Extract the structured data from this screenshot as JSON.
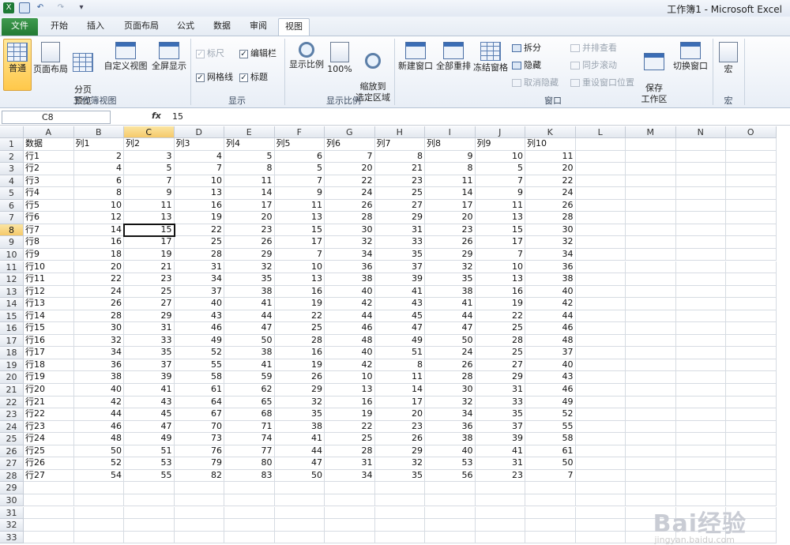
{
  "window": {
    "title": "工作簿1 - Microsoft Excel"
  },
  "tabs": [
    "文件",
    "开始",
    "插入",
    "页面布局",
    "公式",
    "数据",
    "审阅",
    "视图"
  ],
  "active_tab": "视图",
  "ribbon": {
    "groups": [
      {
        "label": "工作簿视图",
        "buttons": [
          "普通",
          "页面布局",
          "分页\n预览",
          "自定义视图",
          "全屏显示"
        ]
      },
      {
        "label": "显示",
        "checkboxes": [
          {
            "label": "标尺",
            "checked": true,
            "disabled": true
          },
          {
            "label": "编辑栏",
            "checked": true
          },
          {
            "label": "网格线",
            "checked": true
          },
          {
            "label": "标题",
            "checked": true
          }
        ]
      },
      {
        "label": "显示比例",
        "buttons": [
          "显示比例",
          "100%",
          "缩放到\n选定区域"
        ]
      },
      {
        "label": "窗口",
        "buttons": [
          "新建窗口",
          "全部重排",
          "冻结窗格"
        ],
        "small": [
          "拆分",
          "隐藏",
          "取消隐藏",
          "并排查看",
          "同步滚动",
          "重设窗口位置"
        ],
        "big2": [
          "保存\n工作区",
          "切换窗口"
        ]
      },
      {
        "label": "宏",
        "buttons": [
          "宏"
        ]
      }
    ]
  },
  "namebox": "C8",
  "fx": "fx",
  "formula_value": "15",
  "columns": [
    "A",
    "B",
    "C",
    "D",
    "E",
    "F",
    "G",
    "H",
    "I",
    "J",
    "K",
    "L",
    "M",
    "N",
    "O"
  ],
  "selected_col": "C",
  "selected_row": 8,
  "header_row": [
    "数据",
    "列1",
    "列2",
    "列3",
    "列4",
    "列5",
    "列6",
    "列7",
    "列8",
    "列9",
    "列10"
  ],
  "rows": [
    [
      "行1",
      2,
      3,
      4,
      5,
      6,
      7,
      8,
      9,
      10,
      11
    ],
    [
      "行2",
      4,
      5,
      7,
      8,
      5,
      20,
      21,
      8,
      5,
      20
    ],
    [
      "行3",
      6,
      7,
      10,
      11,
      7,
      22,
      23,
      11,
      7,
      22
    ],
    [
      "行4",
      8,
      9,
      13,
      14,
      9,
      24,
      25,
      14,
      9,
      24
    ],
    [
      "行5",
      10,
      11,
      16,
      17,
      11,
      26,
      27,
      17,
      11,
      26
    ],
    [
      "行6",
      12,
      13,
      19,
      20,
      13,
      28,
      29,
      20,
      13,
      28
    ],
    [
      "行7",
      14,
      15,
      22,
      23,
      15,
      30,
      31,
      23,
      15,
      30
    ],
    [
      "行8",
      16,
      17,
      25,
      26,
      17,
      32,
      33,
      26,
      17,
      32
    ],
    [
      "行9",
      18,
      19,
      28,
      29,
      7,
      34,
      35,
      29,
      7,
      34
    ],
    [
      "行10",
      20,
      21,
      31,
      32,
      10,
      36,
      37,
      32,
      10,
      36
    ],
    [
      "行11",
      22,
      23,
      34,
      35,
      13,
      38,
      39,
      35,
      13,
      38
    ],
    [
      "行12",
      24,
      25,
      37,
      38,
      16,
      40,
      41,
      38,
      16,
      40
    ],
    [
      "行13",
      26,
      27,
      40,
      41,
      19,
      42,
      43,
      41,
      19,
      42
    ],
    [
      "行14",
      28,
      29,
      43,
      44,
      22,
      44,
      45,
      44,
      22,
      44
    ],
    [
      "行15",
      30,
      31,
      46,
      47,
      25,
      46,
      47,
      47,
      25,
      46
    ],
    [
      "行16",
      32,
      33,
      49,
      50,
      28,
      48,
      49,
      50,
      28,
      48
    ],
    [
      "行17",
      34,
      35,
      52,
      38,
      16,
      40,
      51,
      24,
      25,
      37
    ],
    [
      "行18",
      36,
      37,
      55,
      41,
      19,
      42,
      8,
      26,
      27,
      40
    ],
    [
      "行19",
      38,
      39,
      58,
      59,
      26,
      10,
      11,
      28,
      29,
      43
    ],
    [
      "行20",
      40,
      41,
      61,
      62,
      29,
      13,
      14,
      30,
      31,
      46
    ],
    [
      "行21",
      42,
      43,
      64,
      65,
      32,
      16,
      17,
      32,
      33,
      49
    ],
    [
      "行22",
      44,
      45,
      67,
      68,
      35,
      19,
      20,
      34,
      35,
      52
    ],
    [
      "行23",
      46,
      47,
      70,
      71,
      38,
      22,
      23,
      36,
      37,
      55
    ],
    [
      "行24",
      48,
      49,
      73,
      74,
      41,
      25,
      26,
      38,
      39,
      58
    ],
    [
      "行25",
      50,
      51,
      76,
      77,
      44,
      28,
      29,
      40,
      41,
      61
    ],
    [
      "行26",
      52,
      53,
      79,
      80,
      47,
      31,
      32,
      53,
      31,
      50
    ],
    [
      "行27",
      54,
      55,
      82,
      83,
      50,
      34,
      35,
      56,
      23,
      7
    ]
  ],
  "row_numbers": [
    1,
    2,
    3,
    4,
    5,
    6,
    7,
    8,
    9,
    10,
    11,
    12,
    13,
    14,
    15,
    16,
    17,
    18,
    19,
    20,
    21,
    22,
    23,
    24,
    25,
    26,
    27,
    28,
    29,
    30,
    31,
    32,
    33
  ],
  "watermark": {
    "brand": "Bai经验",
    "url": "jingyan.baidu.com"
  },
  "colors": {
    "file_tab": "#237a33",
    "selection_header": "#f5c96a",
    "active_button": "#ffc84a"
  }
}
